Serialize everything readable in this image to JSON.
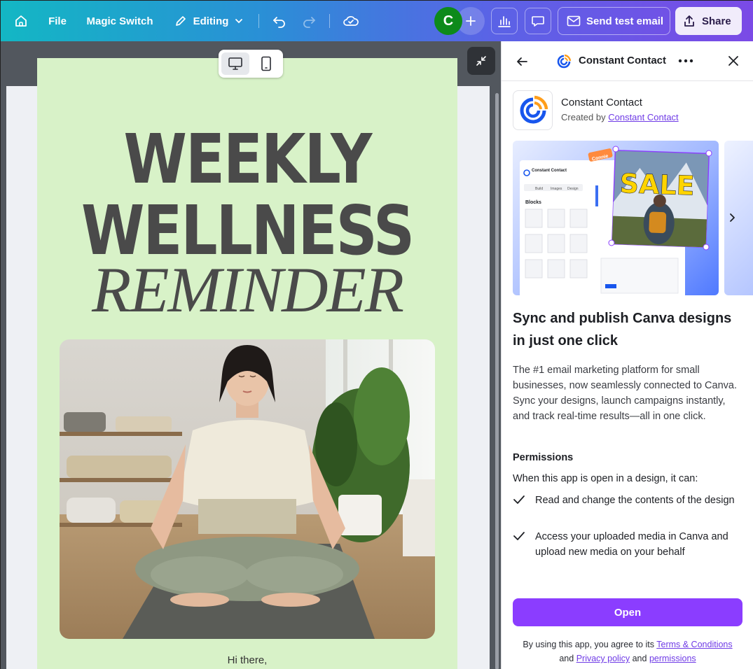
{
  "topbar": {
    "file_label": "File",
    "magic_switch_label": "Magic Switch",
    "editing_label": "Editing",
    "avatar_initial": "C",
    "send_test_email_label": "Send test email",
    "share_label": "Share"
  },
  "email": {
    "headline_line1": "WEEKLY",
    "headline_line2": "WELLNESS",
    "headline_line3": "REMINDER",
    "greeting": "Hi there,"
  },
  "panel": {
    "header_title": "Constant Contact",
    "app_name": "Constant Contact",
    "created_by_prefix": "Created by",
    "created_by_link": "Constant Contact",
    "carousel": {
      "badge": "Connie",
      "sale_text": "SALE",
      "tabs": [
        "Build",
        "Images",
        "Design"
      ],
      "blocks_title": "Blocks",
      "logo_text": "Constant Contact"
    },
    "heading": "Sync and publish Canva designs in just one click",
    "description": "The #1 email marketing platform for small businesses, now seamlessly connected to Canva. Sync your designs, launch campaigns instantly, and track real-time results—all in one click.",
    "permissions_title": "Permissions",
    "permissions_intro": "When this app is open in a design, it can:",
    "permissions": [
      "Read and change the contents of the design",
      "Access your uploaded media in Canva and upload new media on your behalf"
    ],
    "open_label": "Open",
    "terms_prefix": "By using this app, you agree to its",
    "terms_link": "Terms & Conditions",
    "terms_and": "and",
    "privacy_link": "Privacy policy",
    "terms_and2": "and",
    "permissions_link": "permissions"
  },
  "colors": {
    "accent": "#8b3dff",
    "email_bg": "#d8f2c8",
    "headline": "#4a4a4a",
    "avatar": "#0d8a1a"
  }
}
